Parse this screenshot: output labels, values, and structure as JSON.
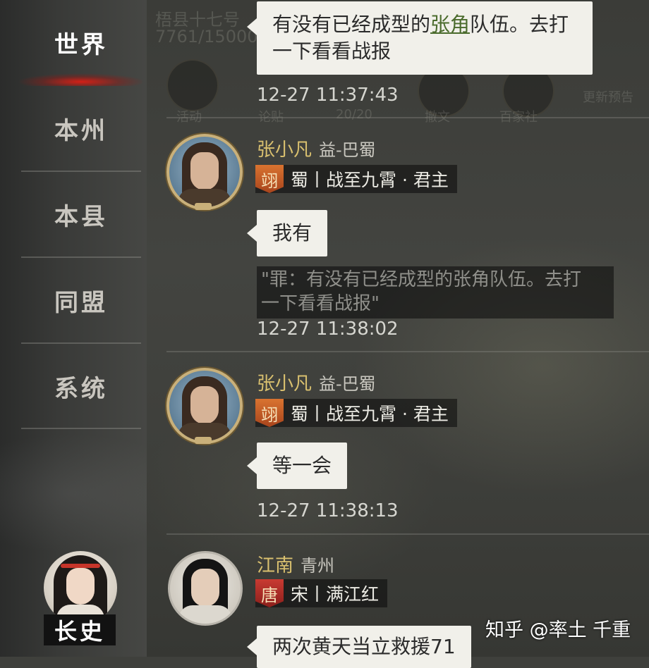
{
  "sidebar": {
    "items": [
      {
        "label": "世界",
        "active": true
      },
      {
        "label": "本州",
        "active": false
      },
      {
        "label": "本县",
        "active": false
      },
      {
        "label": "同盟",
        "active": false
      },
      {
        "label": "系统",
        "active": false
      }
    ],
    "advisor_label": "长史",
    "active_accent": "#d81e14"
  },
  "background": {
    "ghost_title": "梧县十七号",
    "ghost_count": "7761/15000",
    "ghost_count2": "20/20",
    "ghost_labels": [
      "活动",
      "论贴",
      "撤文",
      "百家社",
      "更新预告"
    ]
  },
  "messages": [
    {
      "text_parts": [
        "有没有已经成型的",
        "张角",
        "队伍。去打",
        "一下看看战报"
      ],
      "timestamp": "12-27 11:37:43"
    },
    {
      "sender": "张小凡",
      "region": "益-巴蜀",
      "badge": "翊",
      "title": "蜀丨战至九霄 · 君主",
      "text": "我有",
      "quote_line1": "\"罪：有没有已经成型的张角队伍。去打",
      "quote_line2": "一下看看战报\"",
      "timestamp": "12-27 11:38:02"
    },
    {
      "sender": "张小凡",
      "region": "益-巴蜀",
      "badge": "翊",
      "title": "蜀丨战至九霄 · 君主",
      "text": "等一会",
      "timestamp": "12-27 11:38:13"
    },
    {
      "sender": "江南",
      "region": "青州",
      "badge": "唐",
      "title": "宋丨满江红",
      "text": "两次黄天当立救援71"
    }
  ],
  "watermark": "知乎 @率土 千重",
  "colors": {
    "sender_name": "#d9c06f",
    "bubble_bg": "#f1f0ea",
    "highlight_text": "#4a6b2c"
  }
}
